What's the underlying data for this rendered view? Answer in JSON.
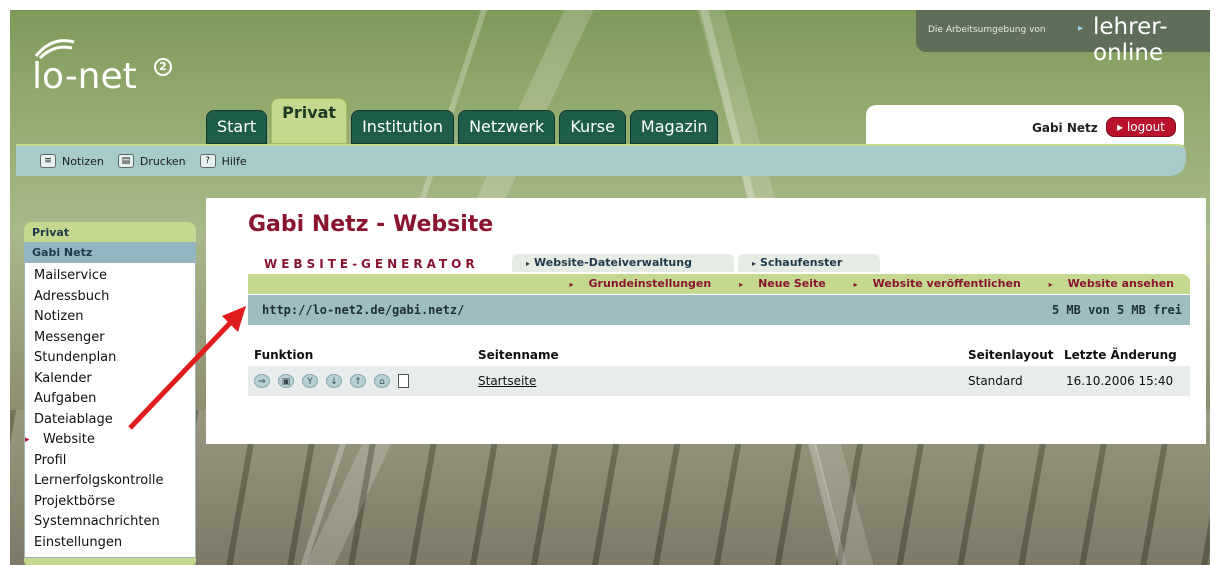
{
  "brand": {
    "logo_text": "lo-net",
    "logo_sup": "2",
    "provider_prefix": "Die Arbeitsumgebung von",
    "provider_name": "lehrer-online"
  },
  "tabs": [
    "Start",
    "Privat",
    "Institution",
    "Netzwerk",
    "Kurse",
    "Magazin"
  ],
  "active_tab": "Privat",
  "user": {
    "name": "Gabi Netz",
    "logout_label": "logout"
  },
  "toolbar": {
    "items": [
      {
        "label": "Notizen",
        "icon": "notes-icon"
      },
      {
        "label": "Drucken",
        "icon": "print-icon"
      },
      {
        "label": "Hilfe",
        "icon": "help-icon"
      }
    ]
  },
  "sidebar": {
    "heading": "Privat",
    "subheading": "Gabi Netz",
    "items": [
      "Mailservice",
      "Adressbuch",
      "Notizen",
      "Messenger",
      "Stundenplan",
      "Kalender",
      "Aufgaben",
      "Dateiablage",
      "Website",
      "Profil",
      "Lernerfolgskontrolle",
      "Projektbörse",
      "Systemnachrichten",
      "Einstellungen"
    ],
    "active_item": "Website"
  },
  "main": {
    "title": "Gabi Netz - Website",
    "generator_label": "WEBSITE-GENERATOR",
    "generator_tabs": [
      "Website-Dateiverwaltung",
      "Schaufenster"
    ],
    "subnav": [
      "Grundeinstellungen",
      "Neue Seite",
      "Website veröffentlichen",
      "Website ansehen"
    ],
    "url": "http://lo-net2.de/gabi.netz/",
    "quota": "5 MB von 5 MB frei",
    "table": {
      "headers": {
        "function": "Funktion",
        "page_name": "Seitenname",
        "layout": "Seitenlayout",
        "modified": "Letzte Änderung"
      },
      "rows": [
        {
          "page_name": "Startseite",
          "layout": "Standard",
          "modified": "16.10.2006 15:40"
        }
      ],
      "row_function_icons": [
        "edit-icon",
        "properties-icon",
        "move-icon",
        "move-down-icon",
        "move-up-icon",
        "delete-icon",
        "page-icon"
      ]
    }
  },
  "colors": {
    "accent": "#8a1430",
    "tab_green": "#1f5d4b",
    "light_green": "#c4d98d",
    "toolbar_blue": "#a8cbc9",
    "logout_red": "#b8122d",
    "arrow": "#e01c1c"
  }
}
